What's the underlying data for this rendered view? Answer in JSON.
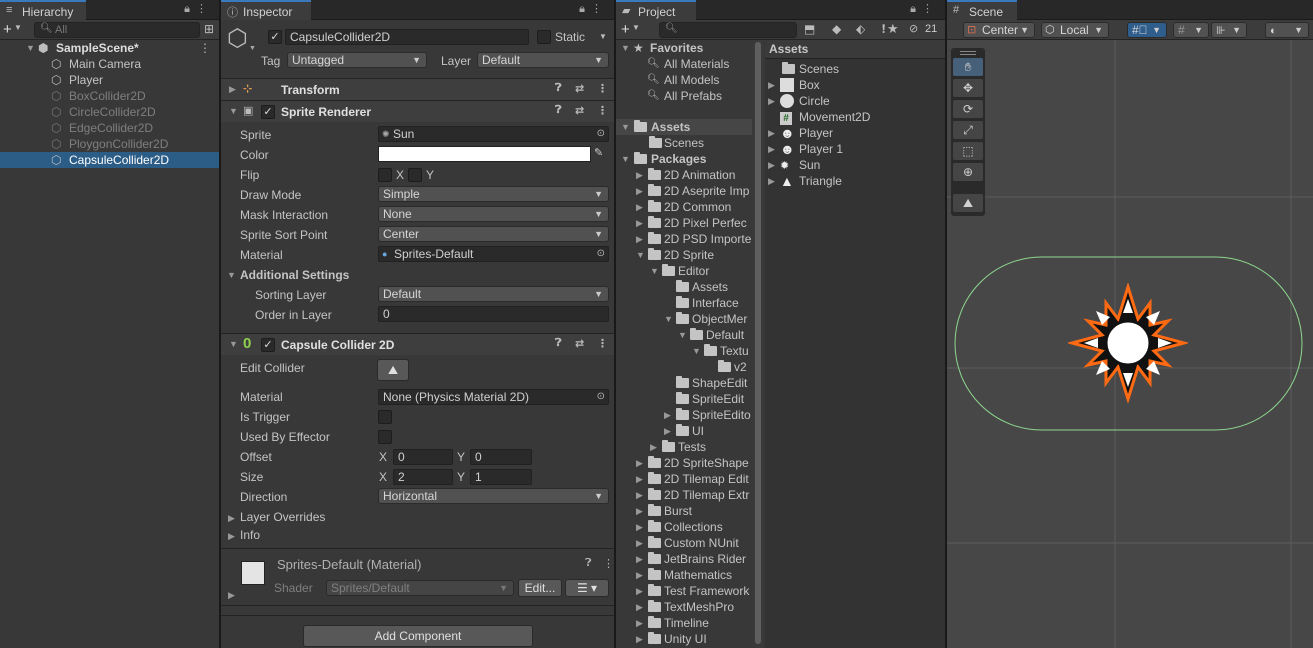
{
  "hierarchy": {
    "tab": "Hierarchy",
    "search_placeholder": "All",
    "scene": "SampleScene*",
    "objects": [
      {
        "name": "Main Camera",
        "active": true,
        "selected": false
      },
      {
        "name": "Player",
        "active": true,
        "selected": false
      },
      {
        "name": "BoxCollider2D",
        "active": false,
        "selected": false
      },
      {
        "name": "CircleCollider2D",
        "active": false,
        "selected": false
      },
      {
        "name": "EdgeCollider2D",
        "active": false,
        "selected": false
      },
      {
        "name": "PloygonCollider2D",
        "active": false,
        "selected": false
      },
      {
        "name": "CapsuleCollider2D",
        "active": true,
        "selected": true
      }
    ]
  },
  "inspector": {
    "tab": "Inspector",
    "object_name": "CapsuleCollider2D",
    "static_label": "Static",
    "tag_label": "Tag",
    "tag_value": "Untagged",
    "layer_label": "Layer",
    "layer_value": "Default",
    "transform_title": "Transform",
    "sprite_renderer": {
      "title": "Sprite Renderer",
      "sprite_label": "Sprite",
      "sprite_value": "Sun",
      "color_label": "Color",
      "flip_label": "Flip",
      "flip_x": "X",
      "flip_y": "Y",
      "draw_mode_label": "Draw Mode",
      "draw_mode_value": "Simple",
      "mask_label": "Mask Interaction",
      "mask_value": "None",
      "sort_point_label": "Sprite Sort Point",
      "sort_point_value": "Center",
      "material_label": "Material",
      "material_value": "Sprites-Default",
      "additional_label": "Additional Settings",
      "sorting_layer_label": "Sorting Layer",
      "sorting_layer_value": "Default",
      "order_label": "Order in Layer",
      "order_value": "0"
    },
    "capsule": {
      "title": "Capsule Collider 2D",
      "badge": "0",
      "edit_label": "Edit Collider",
      "material_label": "Material",
      "material_value": "None (Physics Material 2D)",
      "trigger_label": "Is Trigger",
      "effector_label": "Used By Effector",
      "offset_label": "Offset",
      "offset_x": "0",
      "offset_y": "0",
      "size_label": "Size",
      "size_x": "2",
      "size_y": "1",
      "x_label": "X",
      "y_label": "Y",
      "direction_label": "Direction",
      "direction_value": "Horizontal",
      "layer_overrides": "Layer Overrides",
      "info": "Info"
    },
    "material_preview": {
      "name": "Sprites-Default (Material)",
      "shader_label": "Shader",
      "shader_value": "Sprites/Default",
      "edit_button": "Edit..."
    },
    "add_component": "Add Component"
  },
  "project": {
    "tab": "Project",
    "hidden_count": "21",
    "favorites_label": "Favorites",
    "favorites": [
      "All Materials",
      "All Models",
      "All Prefabs"
    ],
    "assets_label": "Assets",
    "asset_folders": [
      "Scenes"
    ],
    "packages_label": "Packages",
    "packages": [
      {
        "name": "2D Animation",
        "depth": 0,
        "open": false
      },
      {
        "name": "2D Aseprite Imp",
        "depth": 0,
        "open": false
      },
      {
        "name": "2D Common",
        "depth": 0,
        "open": false
      },
      {
        "name": "2D Pixel Perfec",
        "depth": 0,
        "open": false
      },
      {
        "name": "2D PSD Importe",
        "depth": 0,
        "open": false
      },
      {
        "name": "2D Sprite",
        "depth": 0,
        "open": true
      },
      {
        "name": "Editor",
        "depth": 1,
        "open": true
      },
      {
        "name": "Assets",
        "depth": 2,
        "open": null
      },
      {
        "name": "Interface",
        "depth": 2,
        "open": null
      },
      {
        "name": "ObjectMer",
        "depth": 2,
        "open": true
      },
      {
        "name": "Default",
        "depth": 3,
        "open": true
      },
      {
        "name": "Textu",
        "depth": 4,
        "open": true
      },
      {
        "name": "v2",
        "depth": 5,
        "open": null
      },
      {
        "name": "ShapeEdit",
        "depth": 2,
        "open": null
      },
      {
        "name": "SpriteEdit",
        "depth": 2,
        "open": null
      },
      {
        "name": "SpriteEdito",
        "depth": 2,
        "open": false
      },
      {
        "name": "UI",
        "depth": 2,
        "open": false
      },
      {
        "name": "Tests",
        "depth": 1,
        "open": false
      },
      {
        "name": "2D SpriteShape",
        "depth": 0,
        "open": false
      },
      {
        "name": "2D Tilemap Edit",
        "depth": 0,
        "open": false
      },
      {
        "name": "2D Tilemap Extr",
        "depth": 0,
        "open": false
      },
      {
        "name": "Burst",
        "depth": 0,
        "open": false
      },
      {
        "name": "Collections",
        "depth": 0,
        "open": false
      },
      {
        "name": "Custom NUnit",
        "depth": 0,
        "open": false
      },
      {
        "name": "JetBrains Rider",
        "depth": 0,
        "open": false
      },
      {
        "name": "Mathematics",
        "depth": 0,
        "open": false
      },
      {
        "name": "Test Framework",
        "depth": 0,
        "open": false
      },
      {
        "name": "TextMeshPro",
        "depth": 0,
        "open": false
      },
      {
        "name": "Timeline",
        "depth": 0,
        "open": false
      },
      {
        "name": "Unity UI",
        "depth": 0,
        "open": false
      }
    ],
    "content_header": "Assets",
    "content_items": [
      {
        "name": "Scenes",
        "icon": "folder-icon",
        "expandable": false
      },
      {
        "name": "Box",
        "icon": "square-sprite-icon",
        "expandable": true
      },
      {
        "name": "Circle",
        "icon": "circle-sprite-icon",
        "expandable": true
      },
      {
        "name": "Movement2D",
        "icon": "script-icon",
        "expandable": false
      },
      {
        "name": "Player",
        "icon": "smiley-sprite-icon",
        "expandable": true
      },
      {
        "name": "Player 1",
        "icon": "smiley-sprite-icon",
        "expandable": true
      },
      {
        "name": "Sun",
        "icon": "sun-sprite-icon",
        "expandable": true
      },
      {
        "name": "Triangle",
        "icon": "triangle-sprite-icon",
        "expandable": true
      }
    ]
  },
  "scene": {
    "tab": "Scene",
    "pivot": "Center",
    "space": "Local"
  }
}
